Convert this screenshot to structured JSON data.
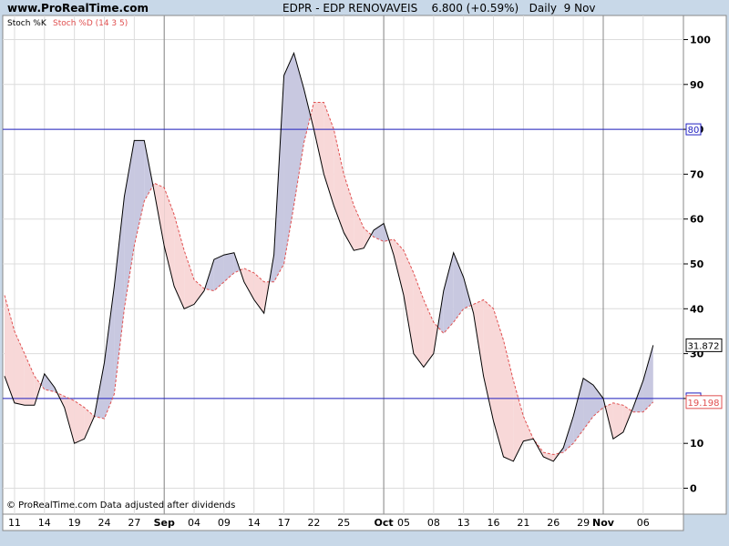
{
  "site": "www.ProRealTime.com",
  "header": {
    "instrument": "EDPR - EDP RENOVAVEIS",
    "price": "6.800 (+0.59%)",
    "period": "Daily",
    "date": "9 Nov"
  },
  "legend": {
    "k": "Stoch %K",
    "d": "Stoch %D (14 3 5)"
  },
  "footer": "© ProRealTime.com  Data adjusted after dividends",
  "colors": {
    "k_line": "#000000",
    "d_line": "#e05050",
    "fill_up": "#c8c8e0",
    "fill_down": "#f8d8d8",
    "level": "#2020c0",
    "bg": "#ffffff",
    "frame_bg": "#c8d8e8"
  },
  "chart_data": {
    "type": "line",
    "ylim": [
      -5,
      102
    ],
    "y_ticks": [
      "0",
      "10",
      "20",
      "30",
      "40",
      "50",
      "60",
      "70",
      "80",
      "90",
      "100"
    ],
    "levels": [
      {
        "value": 80,
        "label": "80"
      },
      {
        "value": 20,
        "label": "20"
      }
    ],
    "last_values": {
      "k": "31.872",
      "d": "19.198"
    },
    "x_labels": [
      {
        "label": "11",
        "idx": 1
      },
      {
        "label": "14",
        "idx": 4
      },
      {
        "label": "19",
        "idx": 7
      },
      {
        "label": "24",
        "idx": 10
      },
      {
        "label": "27",
        "idx": 13
      },
      {
        "label": "Sep",
        "idx": 16,
        "bold": true
      },
      {
        "label": "04",
        "idx": 19
      },
      {
        "label": "09",
        "idx": 22
      },
      {
        "label": "14",
        "idx": 25
      },
      {
        "label": "17",
        "idx": 28
      },
      {
        "label": "22",
        "idx": 31
      },
      {
        "label": "25",
        "idx": 34
      },
      {
        "label": "Oct",
        "idx": 38,
        "bold": true
      },
      {
        "label": "05",
        "idx": 40
      },
      {
        "label": "08",
        "idx": 43
      },
      {
        "label": "13",
        "idx": 46
      },
      {
        "label": "16",
        "idx": 49
      },
      {
        "label": "21",
        "idx": 52
      },
      {
        "label": "26",
        "idx": 55
      },
      {
        "label": "29",
        "idx": 58
      },
      {
        "label": "Nov",
        "idx": 60,
        "bold": true
      },
      {
        "label": "06",
        "idx": 64
      }
    ],
    "month_dividers": [
      16,
      38,
      60
    ],
    "series": [
      {
        "name": "Stoch %K",
        "values": [
          25,
          19,
          18.5,
          18.5,
          25.5,
          22.5,
          18,
          10,
          11,
          16,
          28,
          45,
          65,
          77.5,
          77.5,
          66,
          54,
          45,
          40,
          41,
          44,
          51,
          52,
          52.5,
          46,
          42,
          39,
          52,
          92,
          97,
          89,
          80,
          70,
          63,
          57,
          53,
          53.5,
          57.5,
          59,
          52,
          43,
          30,
          27,
          30,
          44,
          52.5,
          47,
          39,
          25,
          15,
          7,
          6,
          10.5,
          11,
          7,
          6,
          9,
          16,
          24.5,
          23,
          20,
          11,
          12.5,
          18,
          24,
          31.87
        ]
      },
      {
        "name": "Stoch %D (14 3 5)",
        "values": [
          43,
          35,
          30,
          25,
          22,
          21.5,
          20.5,
          19.5,
          18,
          16,
          15.5,
          21,
          40,
          54,
          64,
          68,
          67,
          61,
          53,
          46.5,
          44.5,
          44,
          46,
          48,
          49,
          48,
          46,
          46,
          50,
          63,
          77,
          86,
          86,
          80,
          70,
          63,
          58,
          56,
          55,
          55.5,
          53,
          48,
          42,
          37,
          34.5,
          37,
          40,
          41,
          42,
          40,
          33,
          24,
          16,
          11,
          8,
          7.5,
          8,
          10,
          13,
          16,
          18,
          19,
          18.5,
          17,
          17,
          19.2
        ]
      }
    ]
  }
}
